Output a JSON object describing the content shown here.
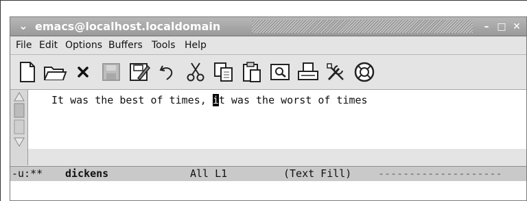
{
  "window": {
    "title": "emacs@localhost.localdomain",
    "buttons": {
      "minimize": "–",
      "maximize": "□",
      "close": "✕"
    }
  },
  "menubar": {
    "items": [
      "File",
      "Edit",
      "Options",
      "Buffers",
      "Tools",
      "Help"
    ]
  },
  "toolbar": {
    "icons": [
      "new-file-icon",
      "open-folder-icon",
      "close-buffer-icon",
      "save-icon",
      "save-as-icon",
      "undo-icon",
      "cut-icon",
      "copy-icon",
      "paste-icon",
      "search-icon",
      "print-icon",
      "customize-icon",
      "help-icon"
    ]
  },
  "buffer": {
    "text_before_cursor": "It was the best of times, ",
    "cursor_char": "i",
    "text_after_cursor": "t was the worst of times"
  },
  "modeline": {
    "status": "-u:**",
    "buffer_name": "dickens",
    "position": "All L1",
    "mode": "(Text Fill)",
    "fill": "--------------------"
  }
}
